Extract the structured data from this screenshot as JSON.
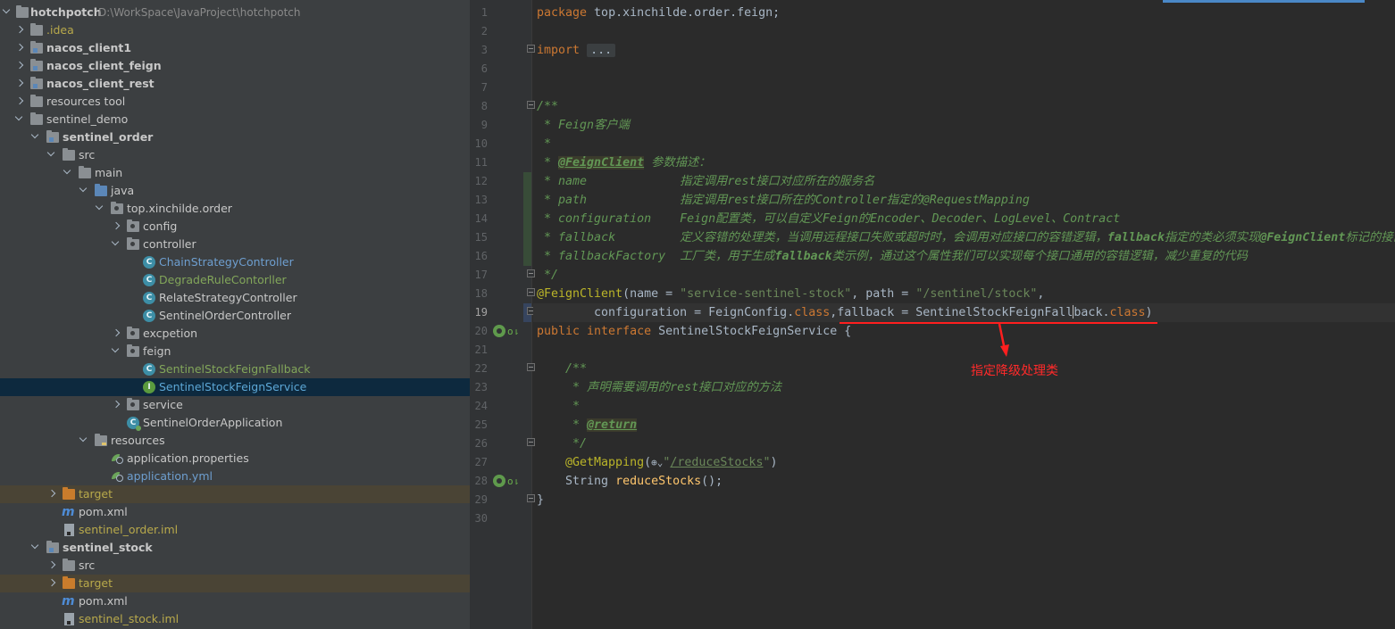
{
  "project_tree": {
    "root": {
      "name": "hotchpotch",
      "path": "D:\\WorkSpace\\JavaProject\\hotchpotch"
    },
    "items": [
      {
        "label": ".idea"
      },
      {
        "label": "nacos_client1"
      },
      {
        "label": "nacos_client_feign"
      },
      {
        "label": "nacos_client_rest"
      },
      {
        "label": "resources tool"
      },
      {
        "label": "sentinel_demo"
      },
      {
        "label": "sentinel_order"
      },
      {
        "label": "src"
      },
      {
        "label": "main"
      },
      {
        "label": "java"
      },
      {
        "label": "top.xinchilde.order"
      },
      {
        "label": "config"
      },
      {
        "label": "controller"
      },
      {
        "label": "ChainStrategyController"
      },
      {
        "label": "DegradeRuleContorller"
      },
      {
        "label": "RelateStrategyController"
      },
      {
        "label": "SentinelOrderController"
      },
      {
        "label": "excpetion"
      },
      {
        "label": "feign"
      },
      {
        "label": "SentinelStockFeignFallback"
      },
      {
        "label": "SentinelStockFeignService"
      },
      {
        "label": "service"
      },
      {
        "label": "SentinelOrderApplication"
      },
      {
        "label": "resources"
      },
      {
        "label": "application.properties"
      },
      {
        "label": "application.yml"
      },
      {
        "label": "target"
      },
      {
        "label": "pom.xml"
      },
      {
        "label": "sentinel_order.iml"
      },
      {
        "label": "sentinel_stock"
      },
      {
        "label": "src"
      },
      {
        "label": "target"
      },
      {
        "label": "pom.xml"
      },
      {
        "label": "sentinel_stock.iml"
      }
    ],
    "icon_letters": {
      "class": "C",
      "interface": "I",
      "maven": "m"
    }
  },
  "editor": {
    "line_numbers": [
      "1",
      "2",
      "3",
      "6",
      "7",
      "8",
      "9",
      "10",
      "11",
      "12",
      "13",
      "14",
      "15",
      "16",
      "17",
      "18",
      "19",
      "20",
      "21",
      "22",
      "23",
      "24",
      "25",
      "26",
      "27",
      "28",
      "29",
      "30"
    ],
    "code": {
      "l1_kw": "package",
      "l1_rest": " top.xinchilde.order.feign;",
      "l3_kw": "import",
      "l3_fold": "...",
      "l8": "/**",
      "l9": " * Feign客户端",
      "l10": " *",
      "l11_pre": " * ",
      "l11_tag": "@FeignClient",
      "l11_post": " 参数描述：",
      "l12_pre": " * ",
      "l12_param": "name",
      "l12_desc": "             指定调用rest接口对应所在的服务名",
      "l13_pre": " * ",
      "l13_param": "path",
      "l13_desc": "             指定调用rest接口所在的Controller指定的@RequestMapping",
      "l14_pre": " * ",
      "l14_param": "configuration",
      "l14_desc": "    Feign配置类，可以自定义Feign的Encoder、Decoder、LogLevel、Contract",
      "l15_pre": " * ",
      "l15_param": "fallback",
      "l15_desc_a": "         定义容错的处理类，当调用远程接口失败或超时时，会调用对应接口的容错逻辑，",
      "l15_bold_a": "fallback",
      "l15_desc_b": "指定的类必须实现",
      "l15_bold_b": "@FeignClient",
      "l15_desc_c": "标记的接口",
      "l16_pre": " * ",
      "l16_param": "fallbackFactory",
      "l16_desc_a": "  工厂类，用于生成",
      "l16_bold": "fallback",
      "l16_desc_b": "类示例，通过这个属性我们可以实现每个接口通用的容错逻辑，减少重复的代码",
      "l17": " */",
      "l18_ann": "@FeignClient",
      "l18_a": "(name = ",
      "l18_s1": "\"service-sentinel-stock\"",
      "l18_b": ", path = ",
      "l18_s2": "\"/sentinel/stock\"",
      "l18_c": ",",
      "l19_a": "        configuration = FeignConfig.",
      "l19_kw1": "class",
      "l19_b": ",fallback = SentinelStockFeignFall",
      "l19_c": "back.",
      "l19_kw2": "class",
      "l19_d": ")",
      "l20_kw": "public interface",
      "l20_rest": " SentinelStockFeignService {",
      "l22": "    /**",
      "l23": "     * 声明需要调用的rest接口对应的方法",
      "l24": "     *",
      "l25_pre": "     * ",
      "l25_tag": "@return",
      "l26": "     */",
      "l27_ann": "    @GetMapping",
      "l27_a": "(",
      "l27_globe": "⊕⌄",
      "l27_q1": "\"",
      "l27_link": "/reduceStocks",
      "l27_q2": "\"",
      "l27_b": ")",
      "l28_a": "    String ",
      "l28_fn": "reduceStocks",
      "l28_b": "();",
      "l29": "}"
    },
    "gutter_marks": {
      "implemented": "⇂",
      "overriding": "o"
    },
    "annotation_text": "指定降级处理类",
    "colors": {
      "underline": "#ff1f1f",
      "callout": "#ff2a2a"
    }
  }
}
